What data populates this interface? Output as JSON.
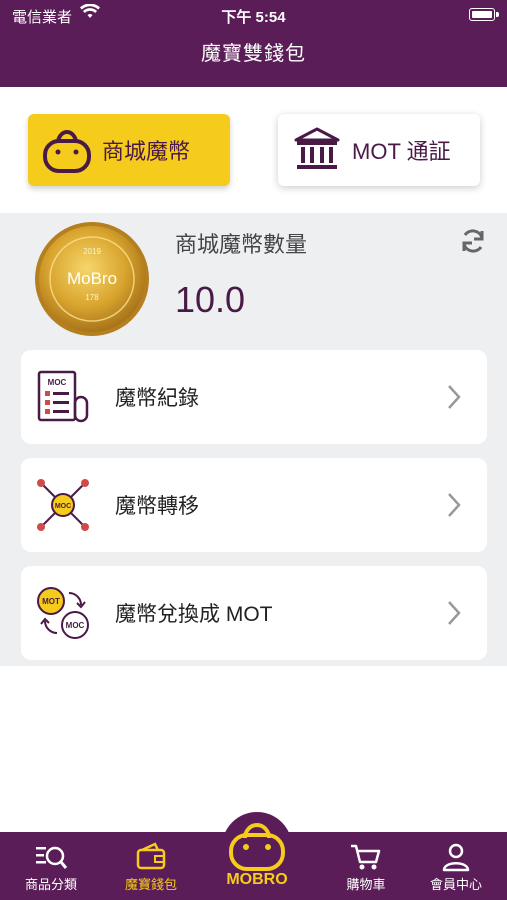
{
  "status_bar": {
    "carrier": "電信業者",
    "time": "下午 5:54"
  },
  "nav": {
    "title": "魔寶雙錢包"
  },
  "wallet_tabs": {
    "mall_coin": "商城魔幣",
    "mot_token": "MOT 通証"
  },
  "balance": {
    "label": "商城魔幣數量",
    "value": "10.0"
  },
  "coin": {
    "brand": "MoBro",
    "number": "178",
    "year": "2019"
  },
  "menu": {
    "items": [
      {
        "label": "魔幣紀錄",
        "icon": "moc-record-icon",
        "icon_text": "MOC"
      },
      {
        "label": "魔幣轉移",
        "icon": "moc-transfer-icon",
        "icon_text": "MOC"
      },
      {
        "label": "魔幣兌換成 MOT",
        "icon": "moc-exchange-icon",
        "icon_text_top": "MOT",
        "icon_text_bottom": "MOC"
      }
    ]
  },
  "tab_bar": {
    "items": [
      {
        "label": "商品分類",
        "icon": "category-search-icon"
      },
      {
        "label": "魔寶錢包",
        "icon": "wallet-icon"
      },
      {
        "label": "MOBRO",
        "icon": "mobro-bag-icon"
      },
      {
        "label": "購物車",
        "icon": "cart-icon"
      },
      {
        "label": "會員中心",
        "icon": "member-icon"
      }
    ]
  },
  "colors": {
    "primary": "#5b1d57",
    "accent": "#f5cc1b",
    "background": "#eeeff1"
  }
}
